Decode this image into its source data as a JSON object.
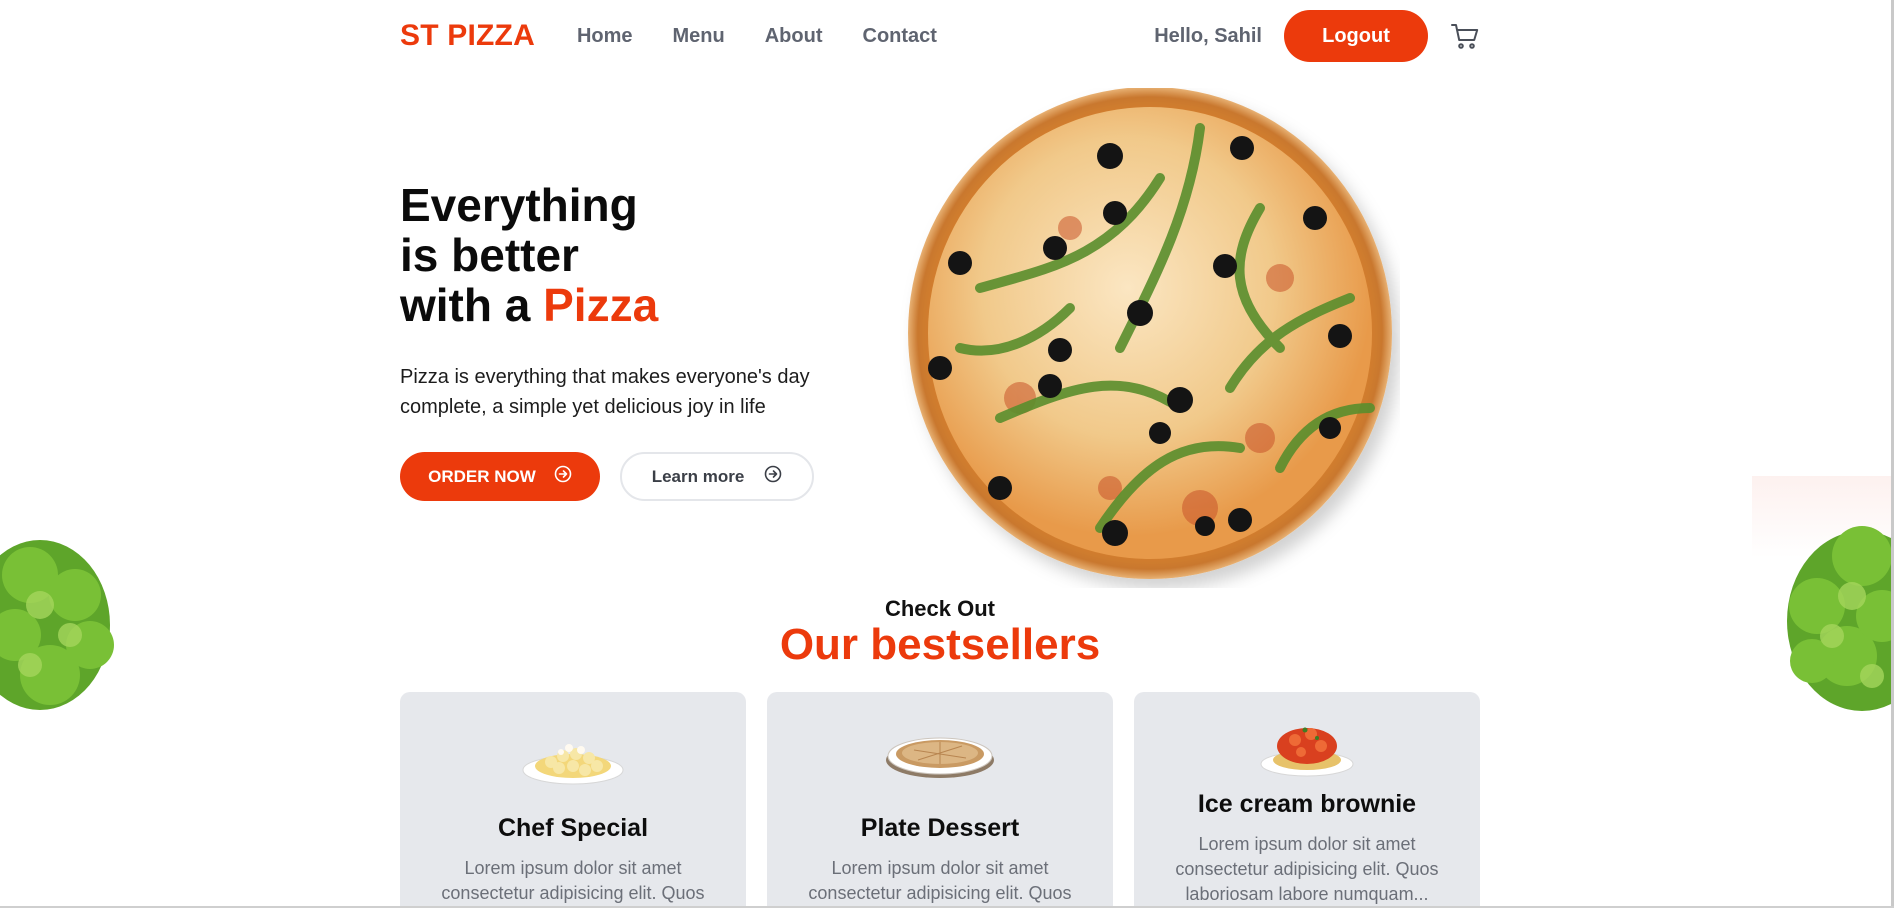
{
  "brand": {
    "name": "ST PIZZA",
    "accent": "#ec3a0c"
  },
  "nav": {
    "items": [
      {
        "label": "Home"
      },
      {
        "label": "Menu"
      },
      {
        "label": "About"
      },
      {
        "label": "Contact"
      }
    ],
    "greeting": "Hello, Sahil",
    "logout_label": "Logout",
    "cart_icon": "cart-icon"
  },
  "hero": {
    "title_line1": "Everything",
    "title_line2": "is better",
    "title_line3_prefix": "with a ",
    "title_line3_accent": "Pizza",
    "description": "Pizza is everything that makes everyone's day complete, a simple yet delicious joy in life",
    "order_label": "ORDER NOW",
    "learn_label": "Learn more",
    "button_icon": "arrow-right-circle-icon"
  },
  "bestsellers": {
    "kicker": "Check Out",
    "title": "Our bestsellers",
    "items": [
      {
        "name": "Chef Special",
        "description": "Lorem ipsum dolor sit amet consectetur adipisicing elit. Quos",
        "image_icon": "gnocchi-plate-icon"
      },
      {
        "name": "Plate Dessert",
        "description": "Lorem ipsum dolor sit amet consectetur adipisicing elit. Quos",
        "image_icon": "flatbread-plate-icon"
      },
      {
        "name": "Ice cream brownie",
        "description": "Lorem ipsum dolor sit amet consectetur adipisicing elit. Quos laboriosam labore numquam...",
        "image_icon": "pasta-sauce-plate-icon"
      }
    ]
  }
}
